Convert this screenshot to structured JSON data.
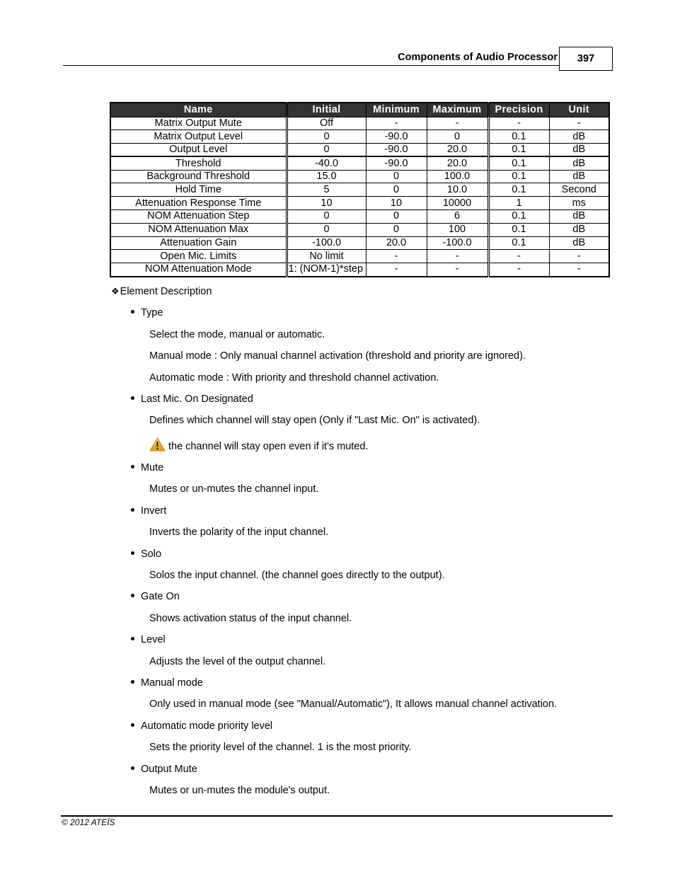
{
  "header": {
    "title": "Components of Audio Processor",
    "page_number": "397"
  },
  "table": {
    "columns": [
      "Name",
      "Initial",
      "Minimum",
      "Maximum",
      "Precision",
      "Unit"
    ],
    "rows": [
      [
        "Matrix Output Mute",
        "Off",
        "-",
        "-",
        "-",
        "-"
      ],
      [
        "Matrix Output Level",
        "0",
        "-90.0",
        "0",
        "0.1",
        "dB"
      ],
      [
        "Output Level",
        "0",
        "-90.0",
        "20.0",
        "0.1",
        "dB"
      ],
      [
        "Threshold",
        "-40.0",
        "-90.0",
        "20.0",
        "0.1",
        "dB"
      ],
      [
        "Background Threshold",
        "15.0",
        "0",
        "100.0",
        "0.1",
        "dB"
      ],
      [
        "Hold Time",
        "5",
        "0",
        "10.0",
        "0.1",
        "Second"
      ],
      [
        "Attenuation Response Time",
        "10",
        "10",
        "10000",
        "1",
        "ms"
      ],
      [
        "NOM Attenuation Step",
        "0",
        "0",
        "6",
        "0.1",
        "dB"
      ],
      [
        "NOM Attenuation Max",
        "0",
        "0",
        "100",
        "0.1",
        "dB"
      ],
      [
        "Attenuation Gain",
        "-100.0",
        "20.0",
        "-100.0",
        "0.1",
        "dB"
      ],
      [
        "Open Mic. Limits",
        "No limit",
        "-",
        "-",
        "-",
        "-"
      ],
      [
        "NOM Attenuation Mode",
        "1: (NOM-1)*step",
        "-",
        "-",
        "-",
        "-"
      ]
    ]
  },
  "element_description": {
    "heading": "Element Description",
    "items": [
      {
        "title": "Type",
        "paragraphs": [
          "Select the mode, manual or automatic.",
          "Manual mode :  Only manual channel activation (threshold and priority are ignored).",
          "Automatic mode : With priority and threshold channel activation."
        ]
      },
      {
        "title": "Last Mic. On Designated",
        "paragraphs": [
          "Defines which channel will stay open (Only if \"Last Mic. On\" is activated)."
        ],
        "warning": "the channel will stay open even if it's muted."
      },
      {
        "title": "Mute",
        "paragraphs": [
          "Mutes or un-mutes the channel input."
        ]
      },
      {
        "title": "Invert",
        "paragraphs": [
          "Inverts the polarity of the input channel."
        ]
      },
      {
        "title": "Solo",
        "paragraphs": [
          "Solos the input channel. (the channel goes directly to the output)."
        ]
      },
      {
        "title": "Gate On",
        "paragraphs": [
          "Shows activation status of the input channel."
        ]
      },
      {
        "title": "Level",
        "paragraphs": [
          "Adjusts the level of the output channel."
        ]
      },
      {
        "title": "Manual mode",
        "paragraphs": [
          "Only used in manual mode (see \"Manual/Automatic\"), It allows manual channel activation."
        ]
      },
      {
        "title": "Automatic mode priority level",
        "paragraphs": [
          "Sets the priority level of the channel. 1 is the most priority."
        ]
      },
      {
        "title": "Output Mute",
        "paragraphs": [
          "Mutes or un-mutes the module's output."
        ]
      }
    ]
  },
  "footer": {
    "copyright": "© 2012 ATEÏS"
  },
  "icons": {
    "section_marker": "diamond-cluster-icon",
    "warning": "warning-triangle-icon"
  },
  "colors": {
    "table_header_bg": "#333333",
    "warning_icon": "#F2B705"
  }
}
